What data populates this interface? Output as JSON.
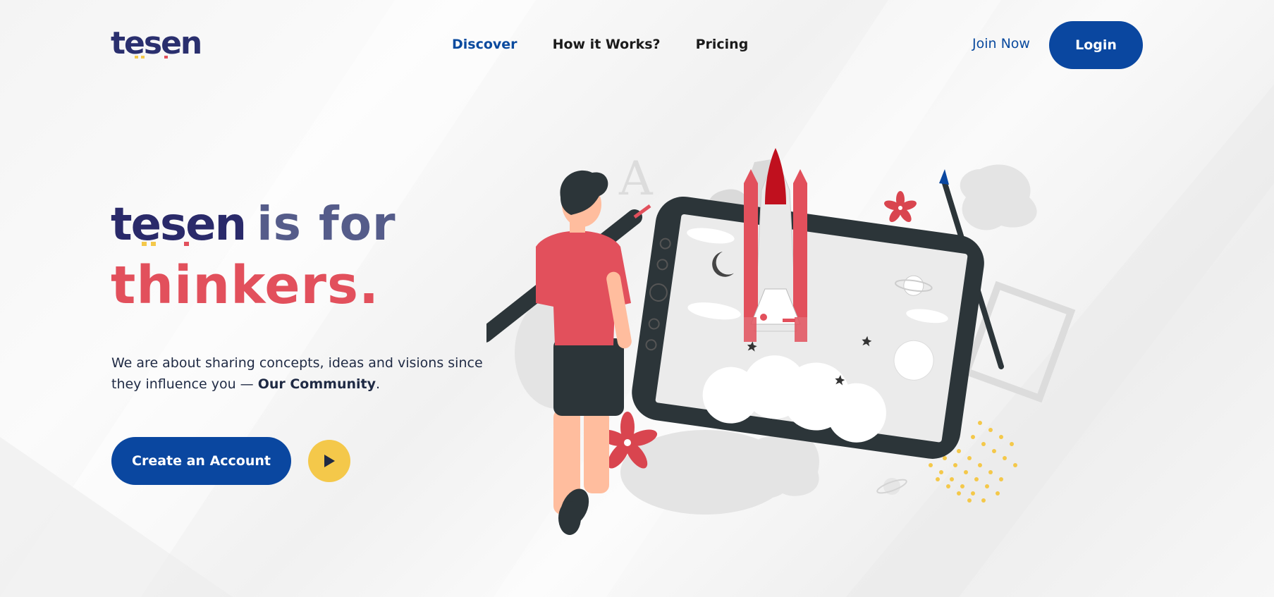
{
  "brand": {
    "logo_text": "tesen",
    "colors": {
      "primary_blue": "#0a47a0",
      "navy": "#2a2f6e",
      "accent_red": "#e2505c",
      "accent_yellow": "#f4c84a",
      "muted_purple": "#555c8a"
    }
  },
  "nav": {
    "items": [
      {
        "label": "Discover",
        "active": true
      },
      {
        "label": "How it Works?",
        "active": false
      },
      {
        "label": "Pricing",
        "active": false
      }
    ]
  },
  "auth": {
    "join_label": "Join Now",
    "login_label": "Login"
  },
  "hero": {
    "logo_text": "tesen",
    "title_rest": "is for",
    "title_line2": "thinkers.",
    "description_part1": "We are about sharing concepts, ideas and visions since they influence you — ",
    "description_bold": "Our Community",
    "description_end": ".",
    "cta_label": "Create an Account",
    "play_icon": "play-icon",
    "illustration": "rocket-launch-tablet-illustration"
  }
}
